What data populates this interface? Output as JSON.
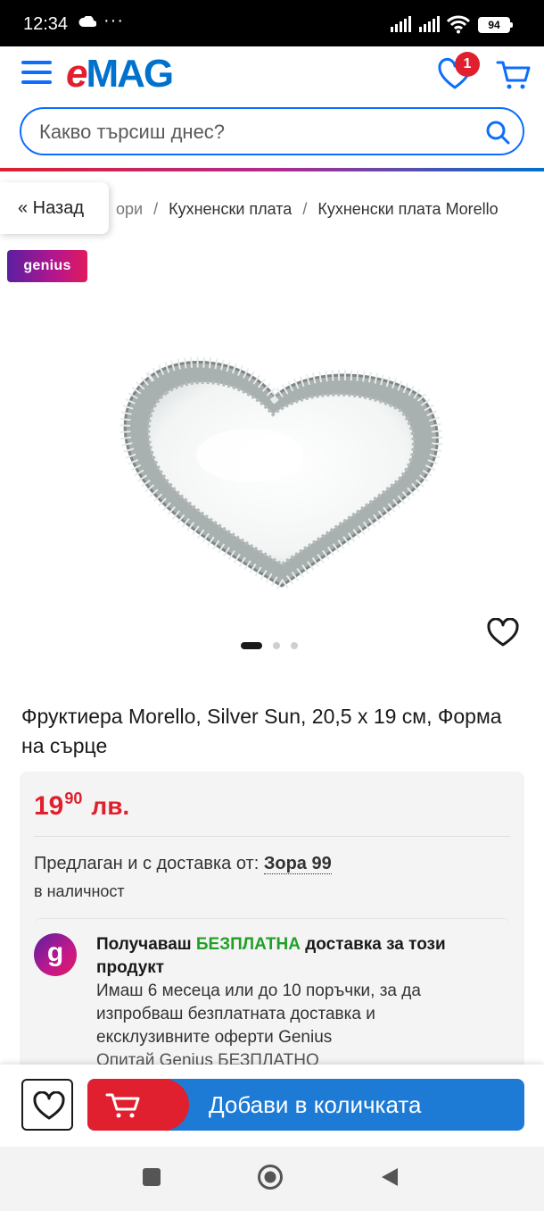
{
  "status_bar": {
    "time": "12:34",
    "overflow": "···",
    "battery": "94"
  },
  "header": {
    "logo": {
      "e": "e",
      "rest": "MAG"
    },
    "wishlist_count": "1",
    "search_placeholder": "Какво търсиш днес?"
  },
  "breadcrumbs": {
    "back_label": "« Назад",
    "items": [
      "ори",
      "Кухненски плата",
      "Кухненски плата Morello"
    ],
    "separator": "/"
  },
  "genius_badge": "genius",
  "gallery": {
    "images": 3,
    "active_index": 0
  },
  "product": {
    "title": "Фруктиера Morello, Silver Sun, 20,5 x 19 см, Форма на сърце",
    "price_whole": "19",
    "price_cents": "90",
    "currency": "лв.",
    "seller_label": "Предлаган и с доставка от:",
    "seller_name": "Зора 99",
    "stock": "в наличност"
  },
  "genius_offer": {
    "logo_letter": "g",
    "line_prefix": "Получаваш",
    "line_free": "БЕЗПЛАТНА",
    "line_suffix": "доставка за този продукт",
    "body": "Имаш 6 месеца или до 10 поръчки, за да изпробваш безплатната доставка и ексклузивните оферти Genius",
    "cta": "Опитай Genius БЕЗПЛАТНО"
  },
  "bottom_bar": {
    "add_to_cart": "Добави в количката"
  },
  "colors": {
    "accent_blue": "#0d6efd",
    "brand_red": "#e0202e",
    "button_blue": "#1d7bd6",
    "free_green": "#22a026"
  }
}
